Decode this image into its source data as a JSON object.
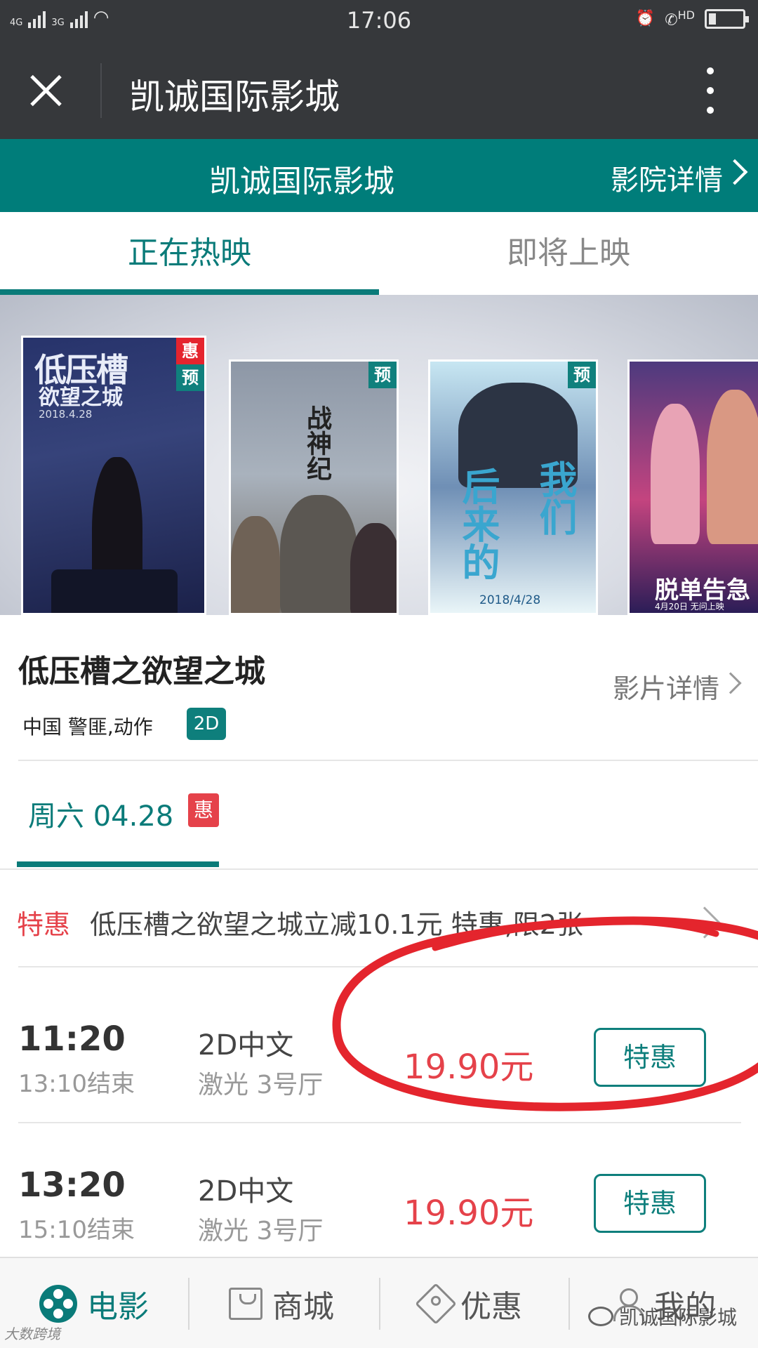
{
  "status_bar": {
    "network_left": "4G",
    "network_right": "3G",
    "time": "17:06",
    "hd_label": "HD",
    "battery_level": 0.2
  },
  "title_bar": {
    "title": "凯诚国际影城"
  },
  "cinema_header": {
    "name": "凯诚国际影城",
    "detail_link": "影院详情"
  },
  "tabs": [
    {
      "label": "正在热映",
      "active": true
    },
    {
      "label": "即将上映",
      "active": false
    }
  ],
  "posters": [
    {
      "title_line1": "低压槽",
      "title_line2": "欲望之城",
      "date": "2018.4.28",
      "badges": [
        "惠",
        "预"
      ],
      "selected": true
    },
    {
      "title_line1": "战神纪",
      "badges": [
        "预"
      ]
    },
    {
      "title_line1": "后来的",
      "title_line2": "我们",
      "date": "2018/4/28",
      "badges": [
        "预"
      ]
    },
    {
      "title_line1": "脱单告急",
      "date": "4月20日 无问上映"
    }
  ],
  "movie": {
    "title": "低压槽之欲望之城",
    "detail_link": "影片详情",
    "meta": "中国 警匪,动作",
    "format_tag": "2D"
  },
  "date_selector": {
    "label": "周六 04.28",
    "badge": "惠"
  },
  "promo": {
    "label": "特惠",
    "text": "低压槽之欲望之城立减10.1元 特惠,限2张"
  },
  "showtimes": [
    {
      "start": "11:20",
      "end": "13:10结束",
      "lang": "2D中文",
      "hall": "激光 3号厅",
      "price": "19.90元",
      "button": "特惠"
    },
    {
      "start": "13:20",
      "end": "15:10结束",
      "lang": "2D中文",
      "hall": "激光 3号厅",
      "price": "19.90元",
      "button": "特惠"
    }
  ],
  "bottom_nav": [
    {
      "label": "电影",
      "icon": "film-reel-icon",
      "active": true
    },
    {
      "label": "商城",
      "icon": "shopping-bag-icon",
      "active": false
    },
    {
      "label": "优惠",
      "icon": "price-tag-icon",
      "active": false
    },
    {
      "label": "我的",
      "icon": "user-icon",
      "active": false
    }
  ],
  "watermark": {
    "account": "凯诚国际影城",
    "corner_text": "大数跨境"
  },
  "colors": {
    "accent": "#0a7b79",
    "title_bar": "#36383b",
    "price_red": "#e5424a",
    "badge_red": "#e5242e"
  }
}
